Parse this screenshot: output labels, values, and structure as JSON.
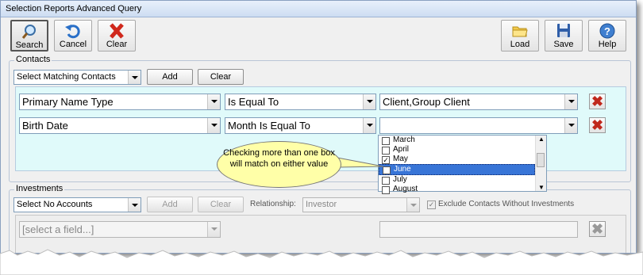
{
  "window": {
    "title": "Selection Reports Advanced Query"
  },
  "toolbar": {
    "search": "Search",
    "cancel": "Cancel",
    "clear": "Clear",
    "load": "Load",
    "save": "Save",
    "help": "Help"
  },
  "contacts": {
    "group_label": "Contacts",
    "match_select": "Select Matching Contacts",
    "add_label": "Add",
    "clear_label": "Clear",
    "rows": [
      {
        "field": "Primary Name Type",
        "operator": "Is Equal To",
        "value": "Client,Group Client"
      },
      {
        "field": "Birth Date",
        "operator": "Month Is Equal To",
        "value": ""
      }
    ]
  },
  "month_list": {
    "items": [
      {
        "label": "March",
        "checked": false,
        "selected": false
      },
      {
        "label": "April",
        "checked": false,
        "selected": false
      },
      {
        "label": "May",
        "checked": true,
        "selected": false
      },
      {
        "label": "June",
        "checked": true,
        "selected": true
      },
      {
        "label": "July",
        "checked": false,
        "selected": false
      },
      {
        "label": "August",
        "checked": false,
        "selected": false
      }
    ]
  },
  "callout": {
    "text": "Checking more than one box will match on either value"
  },
  "investments": {
    "group_label": "Investments",
    "accounts_select": "Select No Accounts",
    "add_label": "Add",
    "clear_label": "Clear",
    "relationship_label": "Relationship:",
    "relationship_value": "Investor",
    "exclude_label": "Exclude Contacts Without Investments",
    "field_placeholder": "[select a field...]"
  },
  "colors": {
    "condition_area": "#e0fafa",
    "delete_red": "#c0281c",
    "selection_blue": "#3875d7",
    "callout_fill": "#ffffa8"
  }
}
